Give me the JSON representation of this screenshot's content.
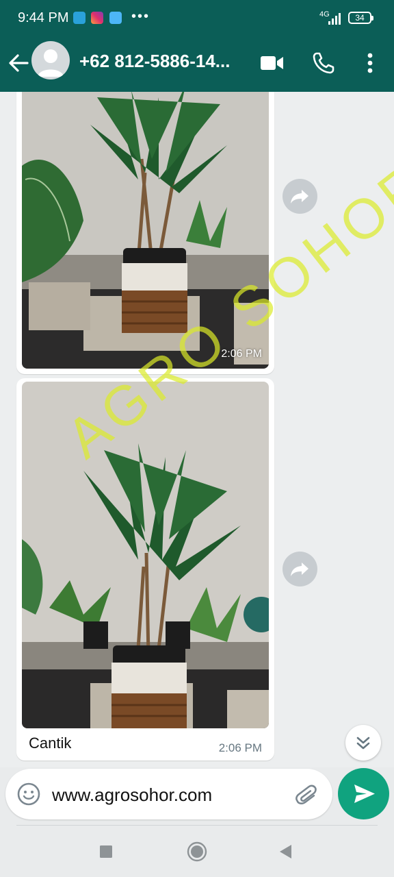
{
  "status_bar": {
    "time": "9:44 PM",
    "more": "•••",
    "network": "4G",
    "battery": "34"
  },
  "header": {
    "contact_name": "+62 812-5886-14..."
  },
  "messages": [
    {
      "type": "image",
      "time": "2:06 PM"
    },
    {
      "type": "image",
      "caption": "Cantik",
      "time": "2:06 PM"
    }
  ],
  "watermark": "AGRO SOHOR",
  "composer": {
    "text": "www.agrosohor.com"
  },
  "colors": {
    "header_bg": "#0b5e57",
    "send_button": "#10a37f",
    "chat_bg": "#eceeef"
  },
  "icons": {
    "back": "arrow-left-icon",
    "video": "video-camera-icon",
    "call": "phone-icon",
    "menu": "more-vert-icon",
    "forward": "forward-icon",
    "scroll": "double-chevron-down-icon",
    "emoji": "emoji-icon",
    "attach": "paperclip-icon",
    "send": "send-icon"
  }
}
